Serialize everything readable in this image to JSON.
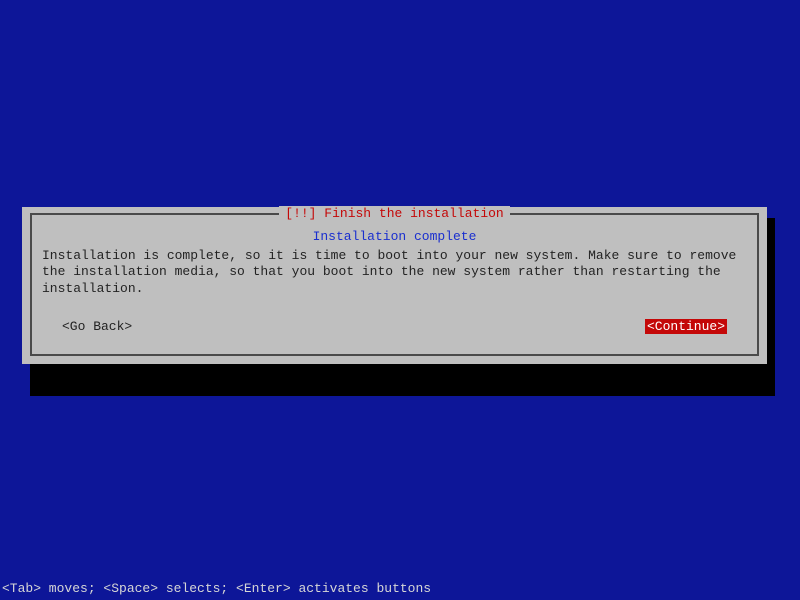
{
  "dialog": {
    "title": "[!!] Finish the installation",
    "subtitle": "Installation complete",
    "body": "Installation is complete, so it is time to boot into your new system. Make sure to remove the installation media, so that you boot into the new system rather than restarting the installation.",
    "go_back": "<Go Back>",
    "continue": "<Continue>"
  },
  "hint": "<Tab> moves; <Space> selects; <Enter> activates buttons"
}
